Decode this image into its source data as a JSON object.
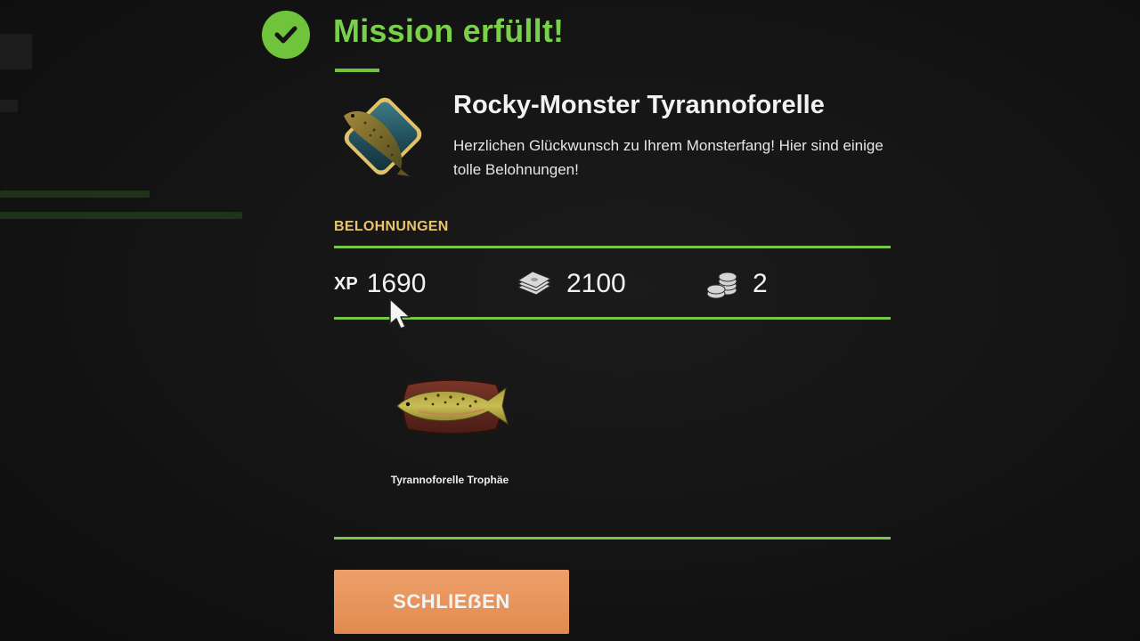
{
  "header": {
    "title": "Mission erfüllt!",
    "accent_color": "#6fc43c",
    "icon": "checkmark-icon"
  },
  "mission": {
    "name": "Rocky-Monster Tyrannoforelle",
    "description": "Herzlichen Glückwunsch zu Ihrem Monsterfang! Hier sind einige tolle Belohnungen!",
    "badge_icon": "trout-badge-icon"
  },
  "rewards": {
    "label": "BELOHNUNGEN",
    "label_color": "#e9c46a",
    "xp_label": "XP",
    "xp_value": "1690",
    "money_value": "2100",
    "money_icon": "banknotes-icon",
    "coins_value": "2",
    "coins_icon": "coins-icon"
  },
  "items": [
    {
      "label": "Tyrannoforelle Trophäe",
      "icon": "trout-trophy-icon"
    }
  ],
  "actions": {
    "close_label": "SCHLIEẞEN",
    "button_color": "#e8955c"
  }
}
